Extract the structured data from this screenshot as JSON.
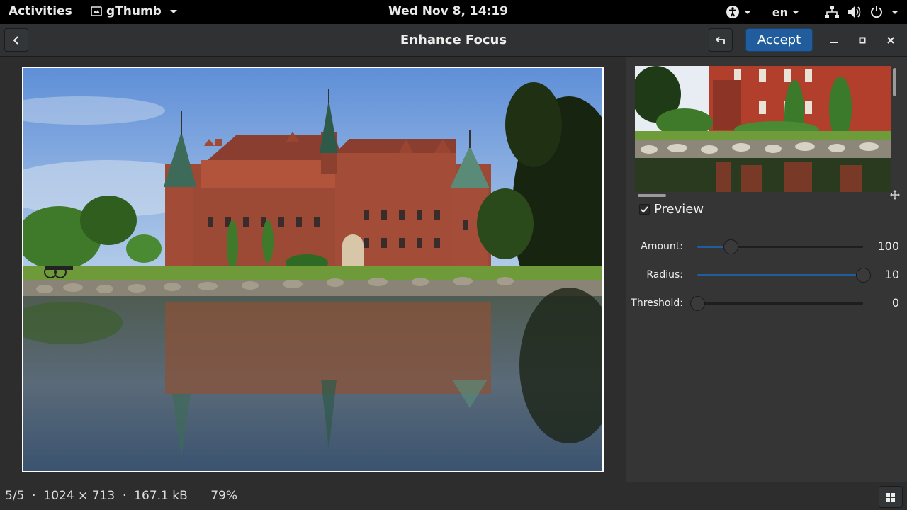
{
  "topbar": {
    "activities": "Activities",
    "app_name": "gThumb",
    "clock": "Wed Nov  8, 14:19",
    "language": "en"
  },
  "headerbar": {
    "title": "Enhance Focus",
    "accept_label": "Accept"
  },
  "sidebar": {
    "preview_label": "Preview",
    "preview_checked": true,
    "sliders": [
      {
        "label": "Amount:",
        "value": "100",
        "fraction": 0.2
      },
      {
        "label": "Radius:",
        "value": "10",
        "fraction": 1.0
      },
      {
        "label": "Threshold:",
        "value": "0",
        "fraction": 0.0
      }
    ]
  },
  "statusbar": {
    "position": "5/5",
    "dimensions": "1024 × 713",
    "filesize": "167.1 kB",
    "zoom": "79%",
    "separator": "·"
  },
  "colors": {
    "accent": "#215d9c",
    "window_bg": "#2d2d2d",
    "sidebar_bg": "#353535"
  },
  "icons": [
    "back-arrow-icon",
    "undo-icon",
    "minimize-icon",
    "maximize-icon",
    "close-icon",
    "accessibility-icon",
    "network-icon",
    "volume-icon",
    "power-icon",
    "move-icon",
    "checkmark-icon",
    "grid-icon"
  ]
}
